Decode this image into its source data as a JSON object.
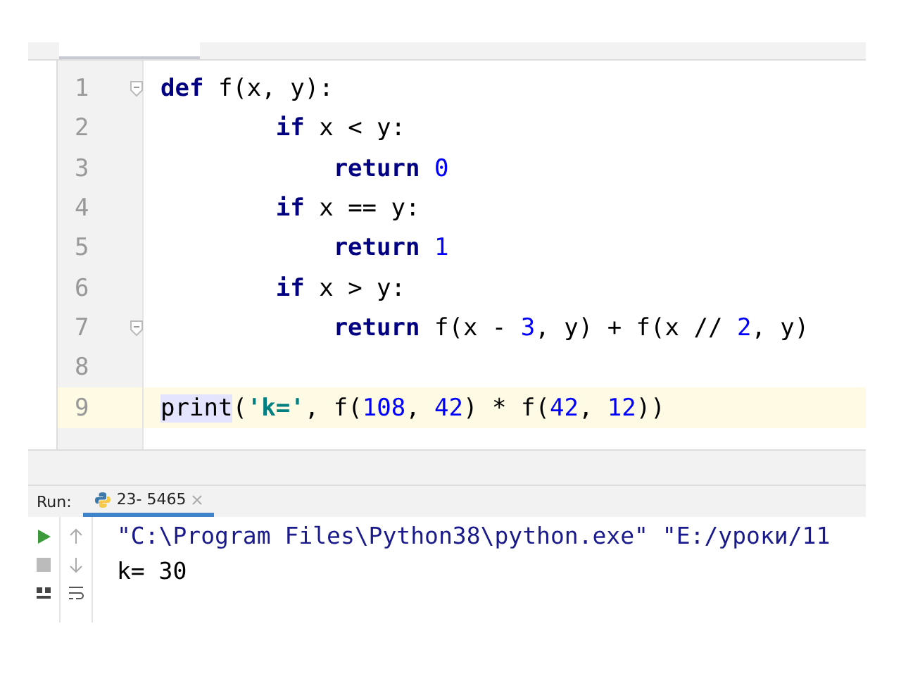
{
  "editor": {
    "lines": [
      {
        "number": "1",
        "current": false,
        "fold": true,
        "tokens": [
          {
            "text": "def",
            "kind": "keyword"
          },
          {
            "text": " f(x, y):",
            "kind": "plain"
          }
        ],
        "children": [
          {
            "number": "2",
            "current": false,
            "tokens": [
              {
                "text": "if",
                "kind": "keyword"
              },
              {
                "text": " x < y:",
                "kind": "plain"
              }
            ],
            "children": [
              {
                "number": "3",
                "current": false,
                "tokens": [
                  {
                    "text": "return",
                    "kind": "keyword"
                  },
                  {
                    "text": "0",
                    "kind": "number"
                  }
                ]
              }
            ]
          },
          {
            "number": "4",
            "current": false,
            "tokens": [
              {
                "text": "if",
                "kind": "keyword"
              },
              {
                "text": " x == y:",
                "kind": "plain"
              }
            ],
            "children": [
              {
                "number": "5",
                "current": false,
                "tokens": [
                  {
                    "text": "return",
                    "kind": "keyword"
                  },
                  {
                    "text": "1",
                    "kind": "number"
                  }
                ]
              }
            ]
          },
          {
            "number": "6",
            "current": false,
            "tokens": [
              {
                "text": "if",
                "kind": "keyword"
              },
              {
                "text": " x > y:",
                "kind": "plain"
              }
            ],
            "children": [
              {
                "number": "7",
                "current": false,
                "fold": true,
                "tokens": [
                  {
                    "text": "return",
                    "kind": "keyword"
                  },
                  {
                    "text": " f(x - ",
                    "kind": "plain"
                  },
                  {
                    "text": "3",
                    "kind": "number"
                  },
                  {
                    "text": ", y) + f(x // ",
                    "kind": "plain"
                  },
                  {
                    "text": "2",
                    "kind": "number"
                  },
                  {
                    "text": ", y)",
                    "kind": "plain"
                  }
                ]
              }
            ]
          }
        ]
      },
      {
        "number": "8",
        "current": false
      },
      {
        "number": "9",
        "current": true,
        "tokens": [
          {
            "text": "print",
            "kind": "usage"
          },
          {
            "text": "(",
            "kind": "plain"
          },
          {
            "text": "'k='",
            "kind": "string"
          },
          {
            "text": ", f(",
            "kind": "plain"
          },
          {
            "text": "108",
            "kind": "number"
          },
          {
            "text": ", ",
            "kind": "plain"
          },
          {
            "text": "42",
            "kind": "number"
          },
          {
            "text": ") * f(",
            "kind": "plain"
          },
          {
            "text": "42",
            "kind": "number"
          },
          {
            "text": ", ",
            "kind": "plain"
          },
          {
            "text": "12",
            "kind": "number"
          },
          {
            "text": "))",
            "kind": "plain"
          }
        ]
      }
    ]
  },
  "run_panel": {
    "label": "Run:",
    "tab": {
      "title": "23- 5465",
      "selected": true
    },
    "output": [
      {
        "text": "\"C:\\Program Files\\Python38\\python.exe\" \"E:/уроки/11",
        "kind": "command"
      },
      {
        "text": "k= 30",
        "kind": "stdout"
      }
    ]
  }
}
